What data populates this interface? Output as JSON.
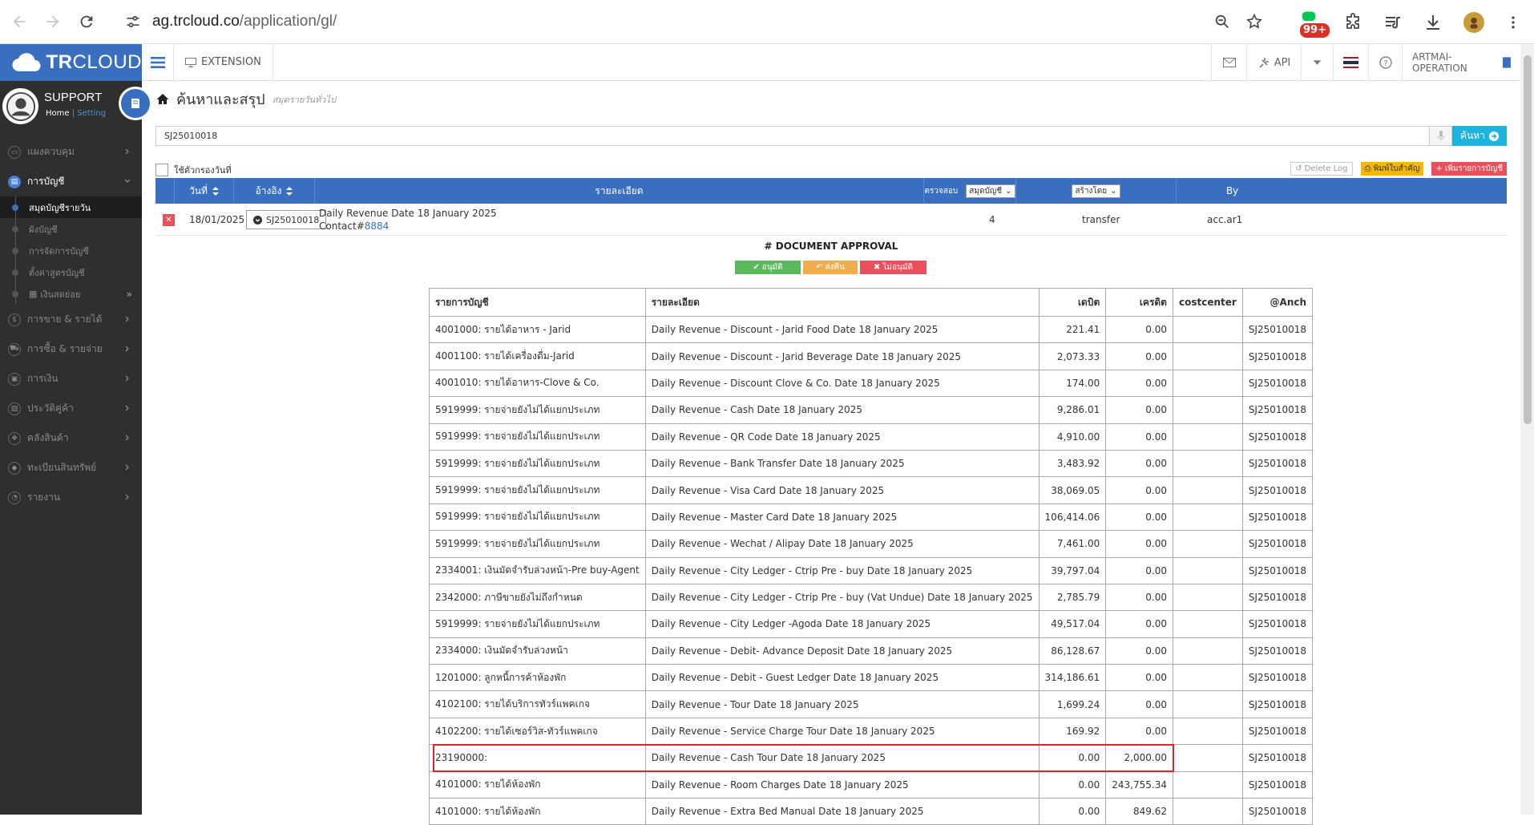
{
  "browser": {
    "url_host": "ag.trcloud.co",
    "url_path": "/application/gl/",
    "extension_badge": "99+"
  },
  "app": {
    "logo_bold": "TR",
    "logo_rest": "CLOUD",
    "extension_label": "EXTENSION",
    "api_label": "API",
    "company": "ARTMAI-OPERATION"
  },
  "sidebar": {
    "profile_name": "SUPPORT",
    "home_link": "Home",
    "setting_link": "Setting",
    "items": [
      {
        "label": "แผงควบคุม",
        "icon": "monitor-icon"
      },
      {
        "label": "การบัญชี",
        "icon": "book-icon"
      },
      {
        "label": "การขาย & รายได้",
        "icon": "dollar-icon"
      },
      {
        "label": "การซื้อ & รายจ่าย",
        "icon": "cart-icon"
      },
      {
        "label": "การเงิน",
        "icon": "calendar-icon"
      },
      {
        "label": "ประวัติคู่ค้า",
        "icon": "contact-icon"
      },
      {
        "label": "คลังสินค้า",
        "icon": "cubes-icon"
      },
      {
        "label": "ทะเบียนสินทรัพย์",
        "icon": "diamond-icon"
      },
      {
        "label": "รายงาน",
        "icon": "report-icon"
      }
    ],
    "subitems": [
      "สมุดบัญชีรายวัน",
      "ผังบัญชี",
      "การจัดการบัญชี",
      "ตั้งค่าสูตรบัญชี",
      "เงินสดย่อย"
    ]
  },
  "page": {
    "title": "ค้นหาและสรุป",
    "subtitle": "สมุดรายวันทั่วไป",
    "search_value": "SJ25010018",
    "search_button": "ค้นหา",
    "filter_label": "ใช้ตัวกรองวันที่",
    "delete_log": "Delete Log",
    "print_button": "พิมพ์ใบสำคัญ",
    "add_button": "เพิ่มรายการบัญชี"
  },
  "list_header": {
    "date": "วันที่",
    "ref": "อ้างอิง",
    "detail": "รายละเอียด",
    "check": "ตรวจสอบ",
    "book_select": "สมุดบัญชี",
    "created_select": "สร้างโดย",
    "by": "By"
  },
  "list_row": {
    "date": "18/01/2025",
    "doc": "SJ25010018",
    "detail": "Daily Revenue Date 18 January 2025",
    "contact_prefix": "Contact#",
    "contact_id": "8884",
    "book": "4",
    "created": "transfer",
    "by": "acc.ar1"
  },
  "approval": {
    "title": "# DOCUMENT APPROVAL",
    "approve": "อนุมัติ",
    "return": "ส่งคืน",
    "reject": "ไม่อนุมัติ"
  },
  "gl_table": {
    "headers": [
      "รายการบัญชี",
      "รายละเอียด",
      "เดบิต",
      "เครดิต",
      "costcenter",
      "@Anch"
    ],
    "rows": [
      {
        "account": "4001000: รายได้อาหาร - Jarid",
        "detail": "Daily Revenue - Discount - Jarid Food Date 18 January 2025",
        "debit": "221.41",
        "credit": "0.00",
        "cc": "",
        "ref": "SJ25010018"
      },
      {
        "account": "4001100: รายได้เครื่องดื่ม-Jarid",
        "detail": "Daily Revenue - Discount - Jarid Beverage Date 18 January 2025",
        "debit": "2,073.33",
        "credit": "0.00",
        "cc": "",
        "ref": "SJ25010018"
      },
      {
        "account": "4001010: รายได้อาหาร-Clove & Co.",
        "detail": "Daily Revenue - Discount Clove & Co. Date 18 January 2025",
        "debit": "174.00",
        "credit": "0.00",
        "cc": "",
        "ref": "SJ25010018"
      },
      {
        "account": "5919999: รายจ่ายยังไม่ได้แยกประเภท",
        "detail": "Daily Revenue - Cash Date 18 January 2025",
        "debit": "9,286.01",
        "credit": "0.00",
        "cc": "",
        "ref": "SJ25010018"
      },
      {
        "account": "5919999: รายจ่ายยังไม่ได้แยกประเภท",
        "detail": "Daily Revenue - QR Code Date 18 January 2025",
        "debit": "4,910.00",
        "credit": "0.00",
        "cc": "",
        "ref": "SJ25010018"
      },
      {
        "account": "5919999: รายจ่ายยังไม่ได้แยกประเภท",
        "detail": "Daily Revenue - Bank Transfer Date 18 January 2025",
        "debit": "3,483.92",
        "credit": "0.00",
        "cc": "",
        "ref": "SJ25010018"
      },
      {
        "account": "5919999: รายจ่ายยังไม่ได้แยกประเภท",
        "detail": "Daily Revenue - Visa Card Date 18 January 2025",
        "debit": "38,069.05",
        "credit": "0.00",
        "cc": "",
        "ref": "SJ25010018"
      },
      {
        "account": "5919999: รายจ่ายยังไม่ได้แยกประเภท",
        "detail": "Daily Revenue - Master Card Date 18 January 2025",
        "debit": "106,414.06",
        "credit": "0.00",
        "cc": "",
        "ref": "SJ25010018"
      },
      {
        "account": "5919999: รายจ่ายยังไม่ได้แยกประเภท",
        "detail": "Daily Revenue - Wechat / Alipay Date 18 January 2025",
        "debit": "7,461.00",
        "credit": "0.00",
        "cc": "",
        "ref": "SJ25010018"
      },
      {
        "account": "2334001: เงินมัดจำรับล่วงหน้า-Pre buy-Agent",
        "detail": "Daily Revenue - City Ledger - Ctrip Pre - buy Date 18 January 2025",
        "debit": "39,797.04",
        "credit": "0.00",
        "cc": "",
        "ref": "SJ25010018"
      },
      {
        "account": "2342000: ภาษีขายยังไม่ถึงกำหนด",
        "detail": "Daily Revenue - City Ledger - Ctrip Pre - buy (Vat Undue) Date 18 January 2025",
        "debit": "2,785.79",
        "credit": "0.00",
        "cc": "",
        "ref": "SJ25010018"
      },
      {
        "account": "5919999: รายจ่ายยังไม่ได้แยกประเภท",
        "detail": "Daily Revenue - City Ledger -Agoda Date 18 January 2025",
        "debit": "49,517.04",
        "credit": "0.00",
        "cc": "",
        "ref": "SJ25010018"
      },
      {
        "account": "2334000: เงินมัดจำรับล่วงหน้า",
        "detail": "Daily Revenue - Debit- Advance Deposit Date 18 January 2025",
        "debit": "86,128.67",
        "credit": "0.00",
        "cc": "",
        "ref": "SJ25010018"
      },
      {
        "account": "1201000: ลูกหนี้การค้าห้องพัก",
        "detail": "Daily Revenue - Debit - Guest Ledger Date 18 January 2025",
        "debit": "314,186.61",
        "credit": "0.00",
        "cc": "",
        "ref": "SJ25010018"
      },
      {
        "account": "4102100: รายได้บริการทัวร์แพคเกจ",
        "detail": "Daily Revenue - Tour Date 18 January 2025",
        "debit": "1,699.24",
        "credit": "0.00",
        "cc": "",
        "ref": "SJ25010018"
      },
      {
        "account": "4102200: รายได้เซอร์วิส-ทัวร์แพคเกจ",
        "detail": "Daily Revenue - Service Charge Tour Date 18 January 2025",
        "debit": "169.92",
        "credit": "0.00",
        "cc": "",
        "ref": "SJ25010018"
      },
      {
        "account": "23190000:",
        "detail": "Daily Revenue - Cash Tour Date 18 January 2025",
        "debit": "0.00",
        "credit": "2,000.00",
        "cc": "",
        "ref": "SJ25010018"
      },
      {
        "account": "4101000: รายได้ห้องพัก",
        "detail": "Daily Revenue - Room Charges Date 18 January 2025",
        "debit": "0.00",
        "credit": "243,755.34",
        "cc": "",
        "ref": "SJ25010018"
      },
      {
        "account": "4101000: รายได้ห้องพัก",
        "detail": "Daily Revenue - Extra Bed Manual Date 18 January 2025",
        "debit": "0.00",
        "credit": "849.62",
        "cc": "",
        "ref": "SJ25010018"
      }
    ],
    "highlighted_row_index": 16
  },
  "colors": {
    "brand_blue": "#3a6fbf",
    "search_blue": "#1fb3e0",
    "sidebar_bg": "#2f2f2f",
    "highlight_red": "#d9262b"
  }
}
